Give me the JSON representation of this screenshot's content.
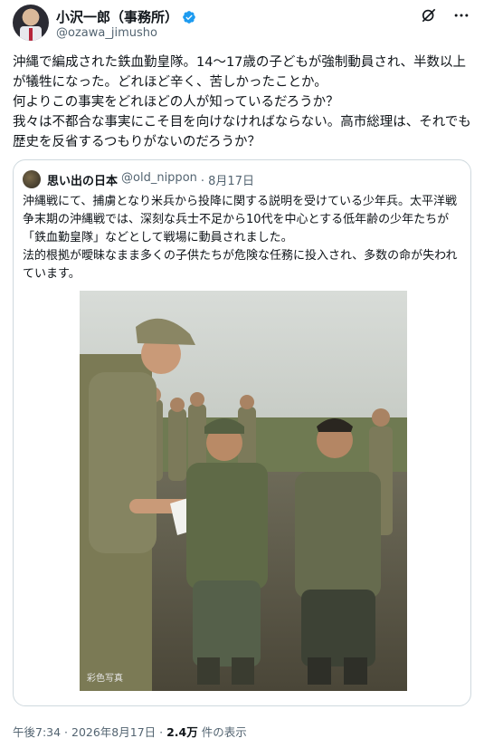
{
  "author": {
    "name": "小沢一郎（事務所）",
    "handle": "@ozawa_jimusho"
  },
  "icons": {
    "verified": "verified-badge-icon",
    "grok": "grok-icon",
    "more": "more-icon"
  },
  "tweet": {
    "text": "沖縄で編成された鉄血勤皇隊。14〜17歳の子どもが強制動員され、半数以上が犠牲になった。どれほど辛く、苦しかったことか。\n何よりこの事実をどれほどの人が知っているだろうか？\n我々は不都合な事実にこそ目を向けなければならない。高市総理は、それでも歴史を反省するつもりがないのだろうか？"
  },
  "quote": {
    "name": "思い出の日本",
    "handle": "@old_nippon",
    "date": "· 8月17日",
    "text": "沖縄戦にて、捕虜となり米兵から投降に関する説明を受けている少年兵。太平洋戦争末期の沖縄戦では、深刻な兵士不足から10代を中心とする低年齢の少年たちが「鉄血勤皇隊」などとして戦場に動員されました。\n法的根拠が曖昧なまま多くの子供たちが危険な任務に投入され、多数の命が失われています。",
    "photo_caption": "彩色写真"
  },
  "footer": {
    "time": "午後7:34 · 2026年8月17日 · ",
    "views": "2.4万",
    "views_suffix": " 件の表示"
  },
  "colors": {
    "verified": "#1d9bf0",
    "border": "#cfd9de",
    "muted": "#536471"
  }
}
